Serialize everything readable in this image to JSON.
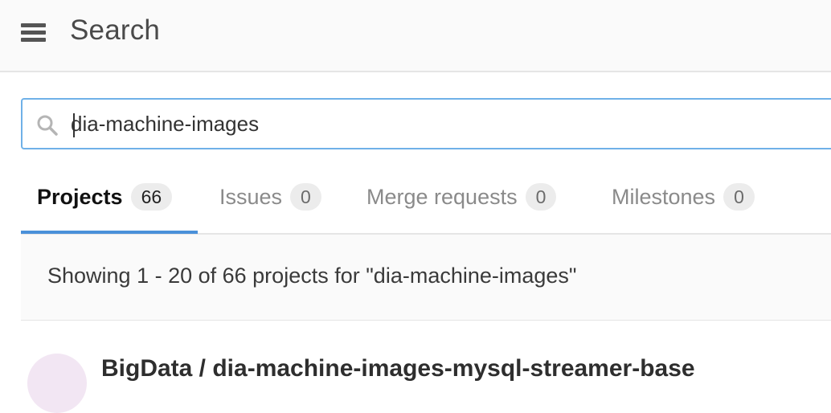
{
  "header": {
    "title": "Search",
    "menu_icon": "hamburger-menu-icon"
  },
  "search": {
    "value": "dia-machine-images",
    "icon": "search-icon"
  },
  "tabs": [
    {
      "label": "Projects",
      "count": "66",
      "active": true
    },
    {
      "label": "Issues",
      "count": "0",
      "active": false
    },
    {
      "label": "Merge requests",
      "count": "0",
      "active": false
    },
    {
      "label": "Milestones",
      "count": "0",
      "active": false
    }
  ],
  "results": {
    "summary": "Showing 1 - 20 of 66 projects for \"dia-machine-images\"",
    "items": [
      {
        "namespace": "BigData",
        "name": "dia-machine-images-mysql-streamer-base",
        "display": "BigData / dia-machine-images-mysql-streamer-base"
      }
    ]
  },
  "colors": {
    "accent": "#4a90d9",
    "search_border": "#6fb1e8",
    "avatar_bg": "#f2e6f3"
  }
}
